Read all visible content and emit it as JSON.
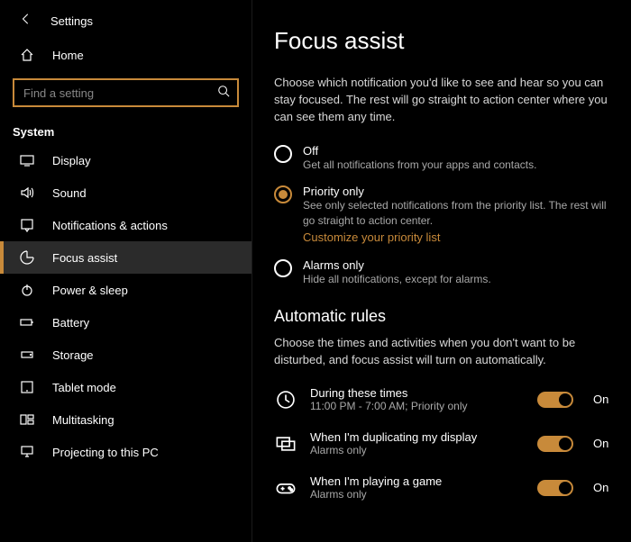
{
  "header": {
    "title": "Settings"
  },
  "nav": {
    "home": "Home",
    "category": "System",
    "items": [
      "Display",
      "Sound",
      "Notifications & actions",
      "Focus assist",
      "Power & sleep",
      "Battery",
      "Storage",
      "Tablet mode",
      "Multitasking",
      "Projecting to this PC"
    ]
  },
  "search": {
    "placeholder": "Find a setting"
  },
  "page": {
    "title": "Focus assist",
    "lead": "Choose which notification you'd like to see and hear so you can stay focused. The rest will go straight to action center where you can see them any time.",
    "options": [
      {
        "title": "Off",
        "desc": "Get all notifications from your apps and contacts."
      },
      {
        "title": "Priority only",
        "desc": "See only selected notifications from the priority list. The rest will go straight to action center.",
        "link": "Customize your priority list"
      },
      {
        "title": "Alarms only",
        "desc": "Hide all notifications, except for alarms."
      }
    ],
    "rules_title": "Automatic rules",
    "rules_lead": "Choose the times and activities when you don't want to be disturbed, and focus assist will turn on automatically.",
    "rules": [
      {
        "title": "During these times",
        "desc": "11:00 PM - 7:00 AM; Priority only",
        "state": "On"
      },
      {
        "title": "When I'm duplicating my display",
        "desc": "Alarms only",
        "state": "On"
      },
      {
        "title": "When I'm playing a game",
        "desc": "Alarms only",
        "state": "On"
      }
    ]
  }
}
